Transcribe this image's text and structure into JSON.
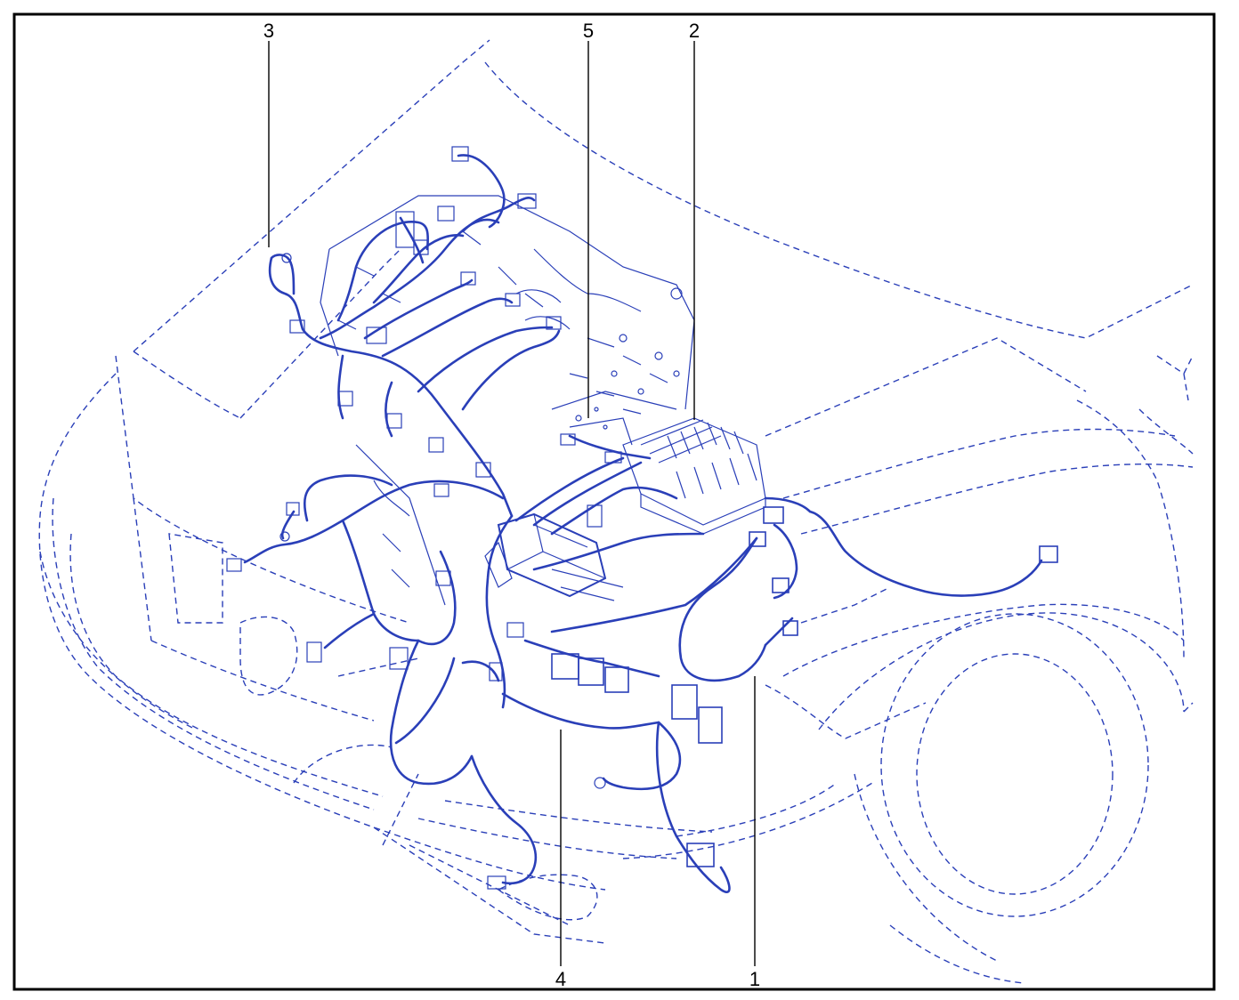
{
  "diagram": {
    "colors": {
      "line": "#2a3fb8",
      "frame": "#000000",
      "background": "#ffffff",
      "label": "#000000"
    },
    "callouts": [
      {
        "id": "c1",
        "label": "1"
      },
      {
        "id": "c2",
        "label": "2"
      },
      {
        "id": "c3",
        "label": "3"
      },
      {
        "id": "c4",
        "label": "4"
      },
      {
        "id": "c5",
        "label": "5"
      }
    ]
  }
}
